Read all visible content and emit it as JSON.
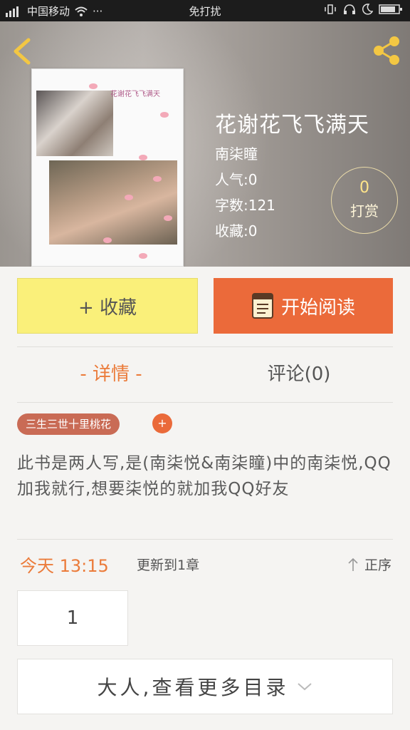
{
  "status_bar": {
    "carrier": "中国移动",
    "dots": "···",
    "mode": "免打扰"
  },
  "book": {
    "title": "花谢花飞飞满天",
    "author": "南柒瞳",
    "popularity": "人气:0",
    "word_count": "字数:121",
    "favorites": "收藏:0",
    "cover_text": "花谢花飞飞满天"
  },
  "reward": {
    "count": "0",
    "label": "打赏"
  },
  "buttons": {
    "favorite": "+ 收藏",
    "read": "开始阅读"
  },
  "tabs": {
    "detail": "- 详情 -",
    "comments": "评论(0)"
  },
  "tag": {
    "label": "三生三世十里桃花",
    "add": "+"
  },
  "description": "此书是两人写,是(南柒悦&南柒瞳)中的南柒悦,QQ加我就行,想要柒悦的就加我QQ好友",
  "update": {
    "time": "今天 13:15",
    "text": "更新到1章",
    "order": "正序"
  },
  "chapters": [
    "1"
  ],
  "more_catalog": "大人,查看更多目录",
  "colors": {
    "accent": "#eb6a3a",
    "favorite_bg": "#faf07a",
    "tag_bg": "#c96b55"
  }
}
